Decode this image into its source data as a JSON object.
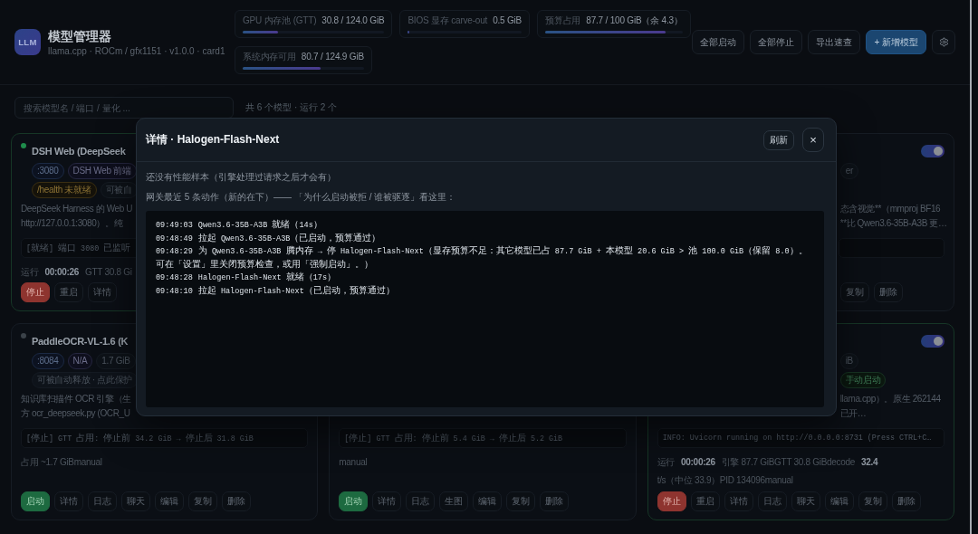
{
  "app": {
    "logo": "LLM",
    "title": "模型管理器",
    "subtitle": "llama.cpp · ROCm / gfx1151 · v1.0.0 · card1"
  },
  "stats": [
    {
      "label": "GPU 内存池 (GTT)",
      "value": "30.8 / 124.0 GiB",
      "level": 0.25
    },
    {
      "label": "BIOS 显存 carve-out",
      "value": "0.5 GiB",
      "level": 0.01
    },
    {
      "label": "预算占用",
      "value": "87.7 / 100 GiB（余 4.3）",
      "level": 0.877
    },
    {
      "label": "系统内存可用",
      "value": "80.7 / 124.9 GiB",
      "level": 0.646
    }
  ],
  "actions": [
    {
      "kind": "plain",
      "label": "全部启动"
    },
    {
      "kind": "plain",
      "label": "全部停止"
    },
    {
      "kind": "plain",
      "label": "导出速查"
    },
    {
      "kind": "primary",
      "label": "+ 新增模型"
    },
    {
      "kind": "settings"
    }
  ],
  "toolbar": {
    "search": {
      "placeholder": "搜索模型名 / 端口 / 量化 ..."
    },
    "summary": "共 6 个模型 · 运行 2 个"
  },
  "cards": [
    {
      "running": true,
      "title": "DSH Web (DeepSeek",
      "tags": [
        {
          "kind": "port",
          "text": ":3080"
        },
        {
          "kind": "accent",
          "text": "DSH Web 前端"
        }
      ],
      "badges": [
        {
          "kind": "warn",
          "text": "/health 未就绪"
        },
        {
          "kind": "plain",
          "text": "可被自"
        }
      ],
      "description": [
        "DeepSeek Harness 的 Web U",
        "http://127.0.0.1:3080）。纯"
      ],
      "log": "[就绪] 端口 3080 已监听",
      "stats": [
        {
          "text": "运行",
          "strong": false
        },
        {
          "text": "00:00:26",
          "strong": true
        },
        {
          "text": "GTT 30.8 Gi",
          "strong": false
        }
      ],
      "buttons": [
        {
          "kind": "danger",
          "label": "停止"
        },
        {
          "kind": "plain",
          "label": "重启"
        },
        {
          "kind": "plain",
          "label": "详情"
        }
      ]
    },
    {
      "running": false,
      "switch_on": true,
      "tags": [
        {
          "kind": "plain",
          "text": "er"
        }
      ],
      "description": [
        "态含视觉**（mmproj BF16",
        "**比 Qwen3.6-35B-A3B 更…"
      ],
      "buttons": [
        {
          "kind": "plain",
          "label": "复制"
        },
        {
          "kind": "plain",
          "label": "删除"
        }
      ]
    },
    {
      "running": false,
      "title": "PaddleOCR-VL-1.6 (K",
      "tags": [
        {
          "kind": "port",
          "text": ":8084"
        },
        {
          "kind": "accent",
          "text": "N/A"
        },
        {
          "kind": "plain",
          "text": "1.7 GiB"
        }
      ],
      "badges": [
        {
          "kind": "muted",
          "text": "可被自动释放 · 点此保护"
        }
      ],
      "description": [
        "知识库扫描件 OCR 引擎（生",
        "方 ocr_deepseek.py (OCR_U"
      ],
      "log": "[停止] GTT 占用: 停止前 34.2 GiB → 停止后 31.8 GiB",
      "stats": [
        {
          "text": "占用 ~1.7 GiBmanual",
          "strong": false
        }
      ],
      "buttons": [
        {
          "kind": "success",
          "label": "启动"
        },
        {
          "kind": "plain",
          "label": "详情"
        },
        {
          "kind": "plain",
          "label": "日志"
        },
        {
          "kind": "plain",
          "label": "聊天"
        },
        {
          "kind": "plain",
          "label": "编辑"
        },
        {
          "kind": "plain",
          "label": "复制"
        },
        {
          "kind": "plain",
          "label": "删除"
        }
      ]
    },
    {
      "running": false,
      "log": "[停止] GTT 占用: 停止前 5.4 GiB → 停止后 5.2 GiB",
      "stats": [
        {
          "text": "manual",
          "strong": false
        }
      ],
      "buttons": [
        {
          "kind": "success",
          "label": "启动"
        },
        {
          "kind": "plain",
          "label": "详情"
        },
        {
          "kind": "plain",
          "label": "日志"
        },
        {
          "kind": "plain",
          "label": "生图"
        },
        {
          "kind": "plain",
          "label": "编辑"
        },
        {
          "kind": "plain",
          "label": "复制"
        },
        {
          "kind": "plain",
          "label": "删除"
        }
      ]
    },
    {
      "running": true,
      "switch_on": true,
      "tags": [
        {
          "kind": "plain",
          "text": "iB"
        }
      ],
      "badges": [
        {
          "kind": "ok",
          "text": "手动启动"
        }
      ],
      "description": [
        "llama.cpp）。原生 262144",
        "已开…"
      ],
      "log": "INFO: Uvicorn running on http://0.0.0.0:8731 (Press CTRL+C…",
      "stats": [
        {
          "text": "运行",
          "strong": false
        },
        {
          "text": "00:00:26",
          "strong": true
        },
        {
          "text": "引擎 87.7 GiBGTT 30.8 GiBdecode",
          "strong": false
        },
        {
          "text": "32.4",
          "strong": true
        },
        {
          "text": "t/s（中位 33.9）PID 134096manual",
          "strong": false
        }
      ],
      "buttons": [
        {
          "kind": "danger",
          "label": "停止"
        },
        {
          "kind": "plain",
          "label": "重启"
        },
        {
          "kind": "plain",
          "label": "详情"
        },
        {
          "kind": "plain",
          "label": "日志"
        },
        {
          "kind": "plain",
          "label": "聊天"
        },
        {
          "kind": "plain",
          "label": "编辑"
        },
        {
          "kind": "plain",
          "label": "复制"
        },
        {
          "kind": "plain",
          "label": "删除"
        }
      ]
    }
  ],
  "dialog": {
    "title": "详情 · Halogen-Flash-Next",
    "refresh": "刷新",
    "close": "×",
    "notes": [
      "还没有性能样本（引擎处理过请求之后才会有）",
      "网关最近 5 条动作（新的在下）—— 「为什么启动被拒 / 谁被驱逐」看这里："
    ],
    "events": [
      {
        "time": "09:49:03",
        "text": "Qwen3.6-35B-A3B 就绪（14s）"
      },
      {
        "time": "09:48:49",
        "text": "拉起 Qwen3.6-35B-A3B（已启动，预算通过）"
      },
      {
        "time": "09:48:29",
        "text": "为 Qwen3.6-35B-A3B 腾内存 → 停 Halogen-Flash-Next（显存预算不足：其它模型已占 87.7 GiB + 本模型 20.6 GiB > 池 100.0 GiB（保留 8.0）。可在「设置」里关闭预算检查，或用「强制启动」。）"
      },
      {
        "time": "09:48:28",
        "text": "Halogen-Flash-Next 就绪（17s）"
      },
      {
        "time": "09:48:10",
        "text": "拉起 Halogen-Flash-Next（已启动，预算通过）"
      }
    ]
  }
}
